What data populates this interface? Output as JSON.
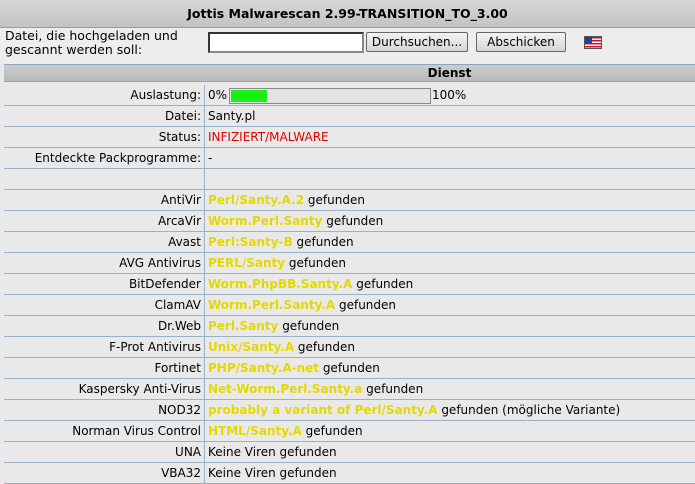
{
  "window": {
    "title": "Jottis Malwarescan 2.99-TRANSITION_TO_3.00"
  },
  "upload": {
    "label": "Datei, die hochgeladen und gescannt werden soll:",
    "file_value": "",
    "browse_label": "Durchsuchen...",
    "submit_label": "Abschicken",
    "language_icon": "us-flag-icon"
  },
  "table_header": {
    "column": "Dienst"
  },
  "info": {
    "load_label": "Auslastung:",
    "load_min": "0%",
    "load_max": "100%",
    "load_fraction": 0.18,
    "file_label": "Datei:",
    "file_value": "Santy.pl",
    "status_label": "Status:",
    "status_value": "INFIZIERT/MALWARE",
    "packers_label": "Entdeckte Packprogramme:",
    "packers_value": "-"
  },
  "results": [
    {
      "engine": "AntiVir",
      "detection": "Perl/Santy.A.2",
      "suffix": " gefunden"
    },
    {
      "engine": "ArcaVir",
      "detection": "Worm.Perl.Santy",
      "suffix": " gefunden"
    },
    {
      "engine": "Avast",
      "detection": "Perl:Santy-B",
      "suffix": " gefunden"
    },
    {
      "engine": "AVG Antivirus",
      "detection": "PERL/Santy",
      "suffix": " gefunden"
    },
    {
      "engine": "BitDefender",
      "detection": "Worm.PhpBB.Santy.A",
      "suffix": " gefunden"
    },
    {
      "engine": "ClamAV",
      "detection": "Worm.Perl.Santy.A",
      "suffix": " gefunden"
    },
    {
      "engine": "Dr.Web",
      "detection": "Perl.Santy",
      "suffix": " gefunden"
    },
    {
      "engine": "F-Prot Antivirus",
      "detection": "Unix/Santy.A",
      "suffix": " gefunden"
    },
    {
      "engine": "Fortinet",
      "detection": "PHP/Santy.A-net",
      "suffix": " gefunden"
    },
    {
      "engine": "Kaspersky Anti-Virus",
      "detection": "Net-Worm.Perl.Santy.a",
      "suffix": " gefunden"
    },
    {
      "engine": "NOD32",
      "detection": "probably a variant of Perl/Santy.A",
      "suffix": " gefunden (mögliche Variante)"
    },
    {
      "engine": "Norman Virus Control",
      "detection": "HTML/Santy.A",
      "suffix": " gefunden"
    },
    {
      "engine": "UNA",
      "detection": "",
      "suffix": "Keine Viren gefunden"
    },
    {
      "engine": "VBA32",
      "detection": "",
      "suffix": "Keine Viren gefunden"
    }
  ],
  "colors": {
    "detection": "#e5d800",
    "infected": "#e00000",
    "load_bar": "#19ee19"
  }
}
